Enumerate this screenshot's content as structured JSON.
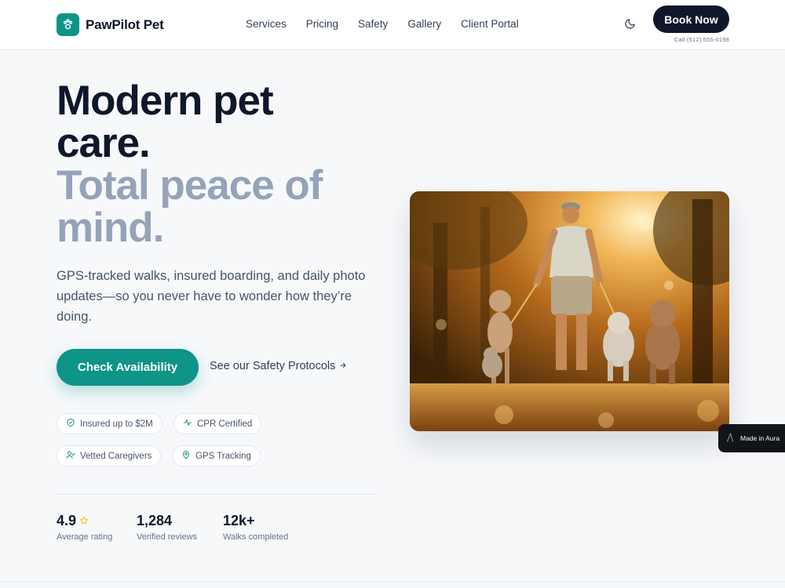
{
  "brand": {
    "name": "PawPilot Pet",
    "accent": "#0f9488",
    "icon": "paw-icon"
  },
  "nav": {
    "items": [
      "Services",
      "Pricing",
      "Safety",
      "Gallery",
      "Client Portal"
    ]
  },
  "header": {
    "theme_icon": "moon-icon",
    "book_label": "Book Now",
    "call_text": "Call (512) 555-0198"
  },
  "hero": {
    "headline_line1": "Modern pet",
    "headline_line2": "care.",
    "headline_line3": "Total peace of",
    "headline_line4": "mind.",
    "subtext": "GPS-tracked walks, insured boarding, and daily photo updates—so you never have to wonder how they’re doing.",
    "cta_primary": "Check Availability",
    "cta_secondary": "See our Safety Protocols",
    "cta_secondary_icon": "arrow-right-icon"
  },
  "badges": [
    {
      "label": "Insured up to $2M",
      "icon": "shield-check-icon"
    },
    {
      "label": "CPR Certified",
      "icon": "pulse-icon"
    },
    {
      "label": "Vetted Caregivers",
      "icon": "user-check-icon"
    },
    {
      "label": "GPS Tracking",
      "icon": "map-pin-icon"
    }
  ],
  "stats": [
    {
      "value": "4.9",
      "label": "Average rating",
      "icon": "star-icon"
    },
    {
      "value": "1,284",
      "label": "Verified reviews"
    },
    {
      "value": "12k+",
      "label": "Walks completed"
    }
  ],
  "photo": {
    "subject": "person-walking-dogs-image"
  },
  "floating": {
    "made_label": "Made in Aura",
    "icon": "aura-logo-icon"
  },
  "colors": {
    "dark": "#0f172a",
    "muted": "#94a3b8",
    "star": "#f5c518"
  }
}
